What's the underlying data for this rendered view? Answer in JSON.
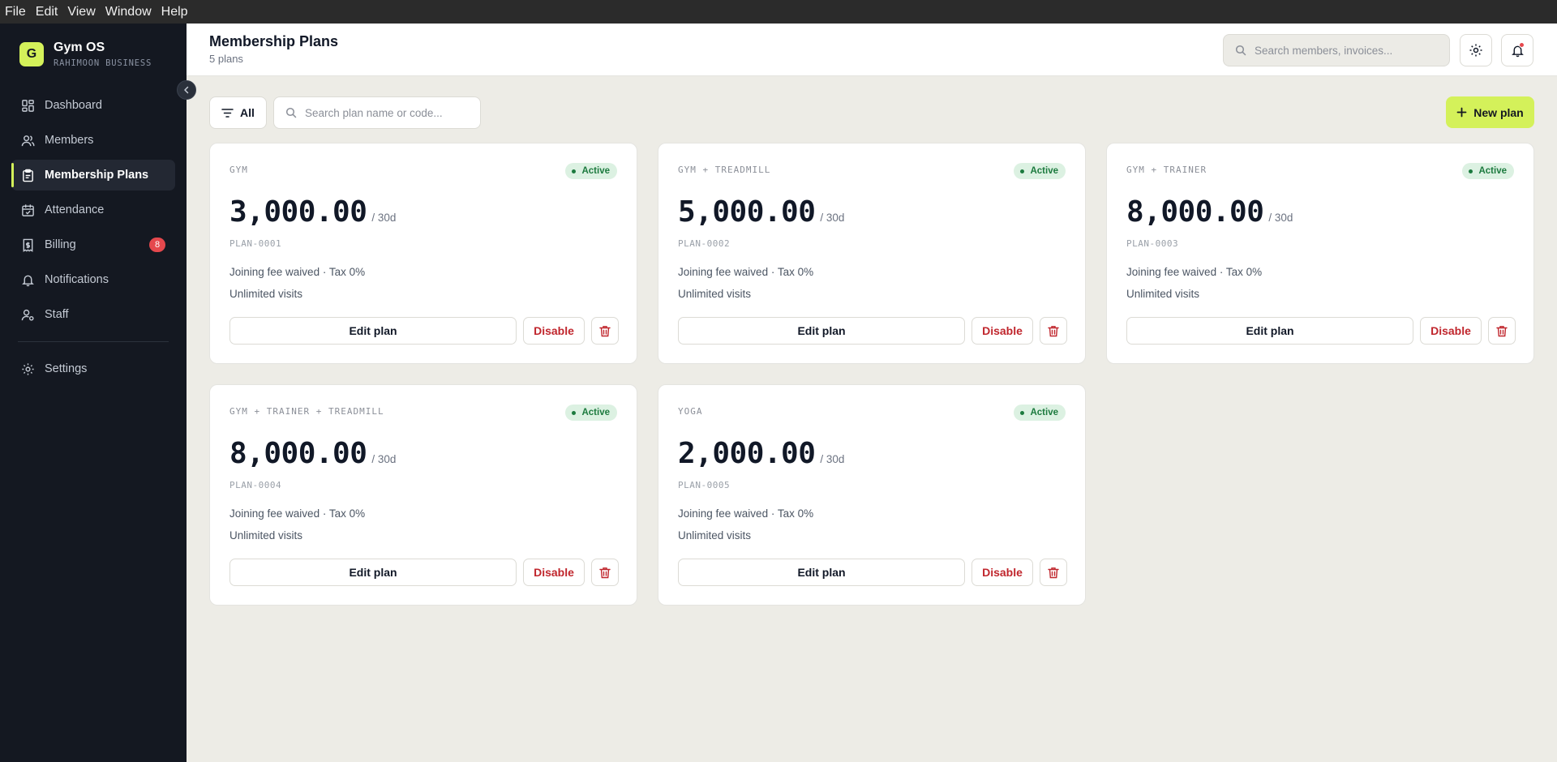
{
  "menubar": {
    "items": [
      "File",
      "Edit",
      "View",
      "Window",
      "Help"
    ]
  },
  "brand": {
    "logo_letter": "G",
    "name": "Gym OS",
    "subtitle": "RAHIMOON BUSINESS",
    "accent_color": "#d4f15a"
  },
  "sidebar": {
    "items": [
      {
        "label": "Dashboard",
        "icon": "dashboard-icon"
      },
      {
        "label": "Members",
        "icon": "users-icon"
      },
      {
        "label": "Membership Plans",
        "icon": "clipboard-icon",
        "active": true
      },
      {
        "label": "Attendance",
        "icon": "calendar-icon"
      },
      {
        "label": "Billing",
        "icon": "receipt-icon",
        "badge": "8"
      },
      {
        "label": "Notifications",
        "icon": "bell-icon"
      },
      {
        "label": "Staff",
        "icon": "staff-icon"
      }
    ],
    "footer_item": {
      "label": "Settings",
      "icon": "gear-icon"
    }
  },
  "header": {
    "title": "Membership Plans",
    "subtitle": "5 plans",
    "search_placeholder": "Search members, invoices..."
  },
  "toolbar": {
    "filter_label": "All",
    "search_placeholder": "Search plan name or code...",
    "new_plan_label": "New plan"
  },
  "plans": [
    {
      "name": "GYM",
      "status": "Active",
      "price": "3,000.00",
      "period": "/ 30d",
      "code": "PLAN-0001",
      "line1": "Joining fee waived · Tax 0%",
      "line2": "Unlimited visits",
      "edit_label": "Edit plan",
      "disable_label": "Disable"
    },
    {
      "name": "GYM + TREADMILL",
      "status": "Active",
      "price": "5,000.00",
      "period": "/ 30d",
      "code": "PLAN-0002",
      "line1": "Joining fee waived · Tax 0%",
      "line2": "Unlimited visits",
      "edit_label": "Edit plan",
      "disable_label": "Disable"
    },
    {
      "name": "GYM + TRAINER",
      "status": "Active",
      "price": "8,000.00",
      "period": "/ 30d",
      "code": "PLAN-0003",
      "line1": "Joining fee waived · Tax 0%",
      "line2": "Unlimited visits",
      "edit_label": "Edit plan",
      "disable_label": "Disable"
    },
    {
      "name": "GYM + TRAINER + TREADMILL",
      "status": "Active",
      "price": "8,000.00",
      "period": "/ 30d",
      "code": "PLAN-0004",
      "line1": "Joining fee waived · Tax 0%",
      "line2": "Unlimited visits",
      "edit_label": "Edit plan",
      "disable_label": "Disable"
    },
    {
      "name": "YOGA",
      "status": "Active",
      "price": "2,000.00",
      "period": "/ 30d",
      "code": "PLAN-0005",
      "line1": "Joining fee waived · Tax 0%",
      "line2": "Unlimited visits",
      "edit_label": "Edit plan",
      "disable_label": "Disable"
    }
  ],
  "colors": {
    "status_active": "#1c7a3e",
    "danger": "#c0262d",
    "badge": "#e5484d"
  }
}
